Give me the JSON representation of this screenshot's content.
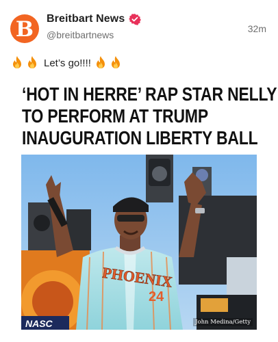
{
  "author": {
    "display_name": "Breitbart News",
    "handle": "@breitbartnews",
    "avatar_letter": "B",
    "avatar_color": "#f26522",
    "verified": true,
    "verified_color": "#e8315a"
  },
  "post": {
    "timestamp": "32m",
    "caption": "Let’s go!!!!",
    "emoji_icon": "fire-emoji",
    "headline_lines": [
      "‘HOT IN HERRE’ RAP STAR NELLY",
      "TO PERFORM AT TRUMP",
      "INAUGURATION LIBERTY BALL"
    ],
    "image": {
      "credit": "John Medina/Getty",
      "jersey_text": "PHOENIX",
      "jersey_number": "24",
      "banner_text": "NASC"
    }
  }
}
